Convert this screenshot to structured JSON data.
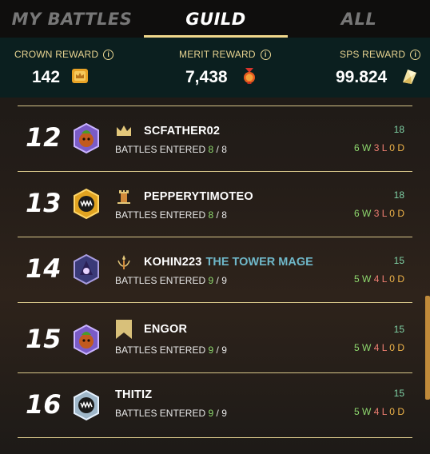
{
  "tabs": [
    {
      "label": "MY BATTLES",
      "active": false
    },
    {
      "label": "GUILD",
      "active": true
    },
    {
      "label": "ALL",
      "active": false
    }
  ],
  "rewards": {
    "crown": {
      "label": "CROWN REWARD",
      "value": "142",
      "icon": "crown-token-icon"
    },
    "merit": {
      "label": "MERIT REWARD",
      "value": "7,438",
      "icon": "merit-medal-icon"
    },
    "sps": {
      "label": "SPS REWARD",
      "value": "99.824",
      "icon": "sps-crystal-icon"
    }
  },
  "rows": [
    {
      "rank": "12",
      "name": "SCFATHER02",
      "title": "",
      "battles_label": "BATTLES ENTERED",
      "entered": "8",
      "total": "8",
      "score": "18",
      "w": "6",
      "l": "3",
      "d": "0",
      "avatar": "pumpkin",
      "badge": "crown"
    },
    {
      "rank": "13",
      "name": "PEPPERYTIMOTEO",
      "title": "",
      "battles_label": "BATTLES ENTERED",
      "entered": "8",
      "total": "8",
      "score": "18",
      "w": "6",
      "l": "3",
      "d": "0",
      "avatar": "monster-gold",
      "badge": "tower"
    },
    {
      "rank": "14",
      "name": "KOHIN223",
      "title": "THE TOWER MAGE",
      "battles_label": "BATTLES ENTERED",
      "entered": "9",
      "total": "9",
      "score": "15",
      "w": "5",
      "l": "4",
      "d": "0",
      "avatar": "mage",
      "badge": "mage-staff"
    },
    {
      "rank": "15",
      "name": "ENGOR",
      "title": "",
      "battles_label": "BATTLES ENTERED",
      "entered": "9",
      "total": "9",
      "score": "15",
      "w": "5",
      "l": "4",
      "d": "0",
      "avatar": "pumpkin",
      "badge": "banner"
    },
    {
      "rank": "16",
      "name": "THITIZ",
      "title": "",
      "battles_label": "BATTLES ENTERED",
      "entered": "9",
      "total": "9",
      "score": "15",
      "w": "5",
      "l": "4",
      "d": "0",
      "avatar": "monster-silver",
      "badge": ""
    }
  ],
  "labels": {
    "w": "W",
    "l": "L",
    "d": "D",
    "sep": "/"
  },
  "colors": {
    "accent": "#e8d491",
    "tab_underline": "#f0d78c",
    "win": "#8ed86e",
    "loss": "#f07f73",
    "draw": "#f0b449",
    "score": "#7fd2a6",
    "title": "#6fb8c9"
  }
}
